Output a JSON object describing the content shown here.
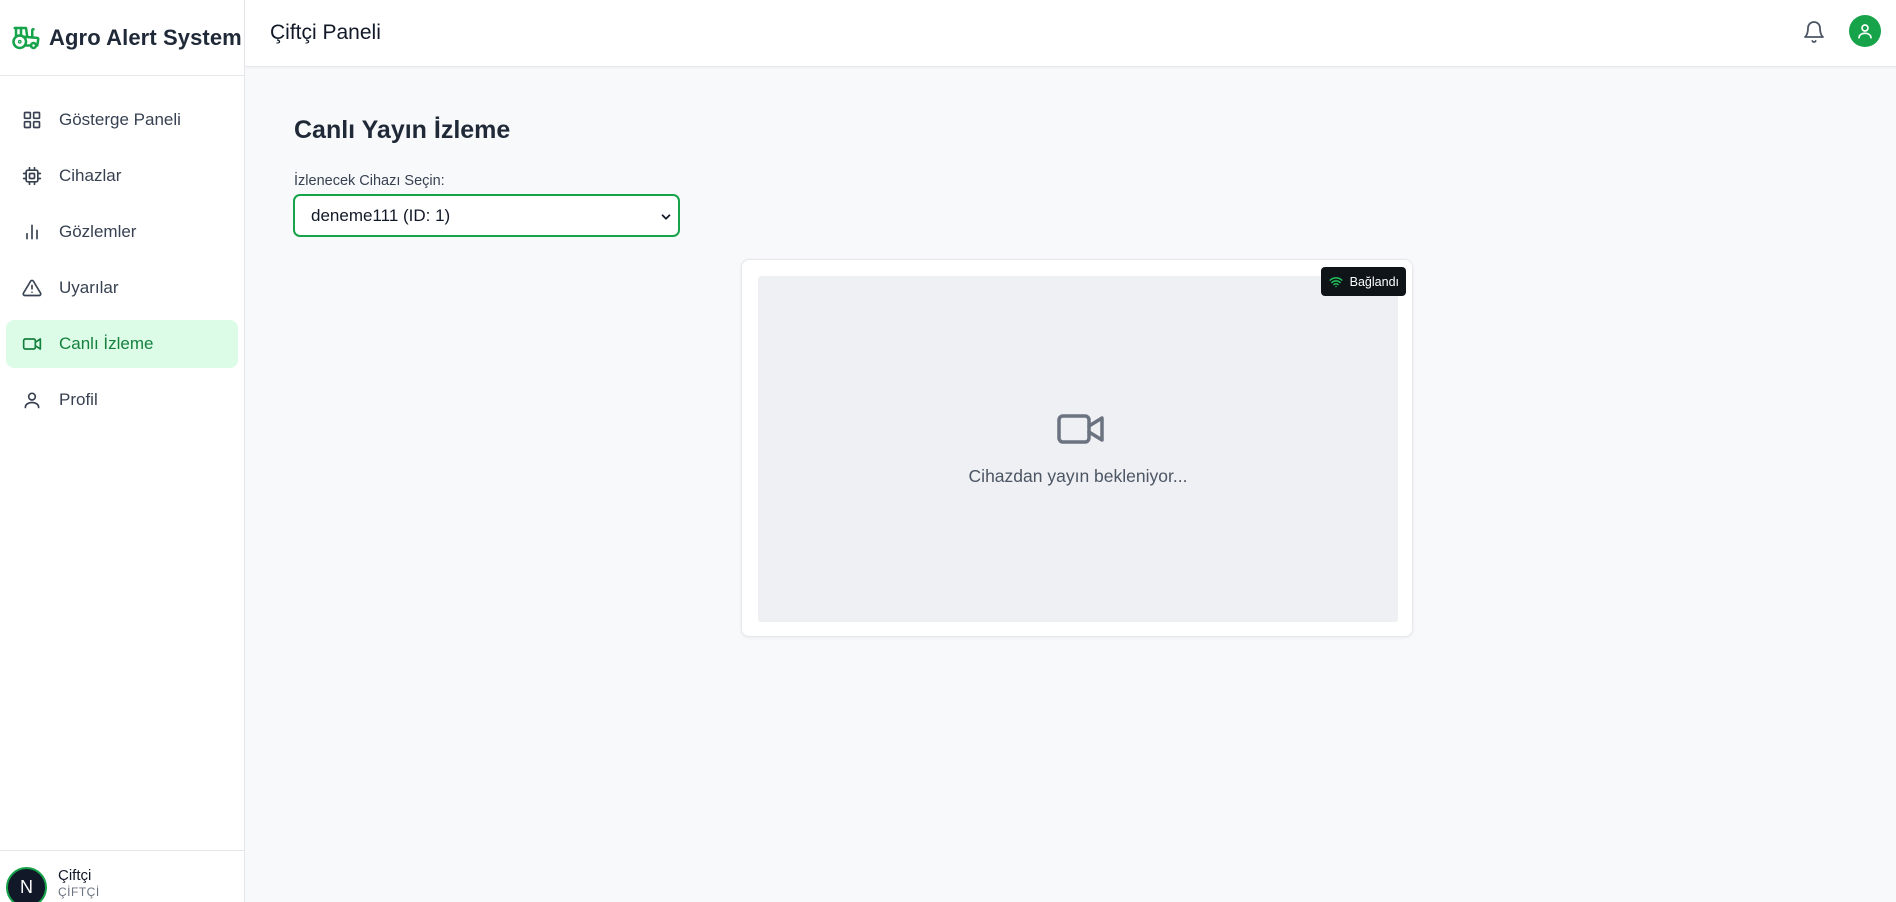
{
  "app": {
    "title": "Agro Alert System"
  },
  "sidebar": {
    "items": [
      {
        "label": "Gösterge Paneli",
        "icon": "grid-icon",
        "active": false
      },
      {
        "label": "Cihazlar",
        "icon": "chip-icon",
        "active": false
      },
      {
        "label": "Gözlemler",
        "icon": "bar-chart-icon",
        "active": false
      },
      {
        "label": "Uyarılar",
        "icon": "warning-triangle-icon",
        "active": false
      },
      {
        "label": "Canlı İzleme",
        "icon": "video-icon",
        "active": true
      },
      {
        "label": "Profil",
        "icon": "user-icon",
        "active": false
      }
    ],
    "user": {
      "initial": "N",
      "name": "Çiftçi",
      "role": "ÇİFTÇİ"
    }
  },
  "header": {
    "title": "Çiftçi Paneli"
  },
  "main": {
    "title": "Canlı Yayın İzleme",
    "select_label": "İzlenecek Cihazı Seçin:",
    "selected_device": "deneme111 (ID: 1)",
    "status": "Bağlandı",
    "waiting_text": "Cihazdan yayın bekleniyor..."
  },
  "colors": {
    "accent": "#16a34a",
    "active_bg": "#dcfce7",
    "badge_bg": "#0f1419"
  }
}
